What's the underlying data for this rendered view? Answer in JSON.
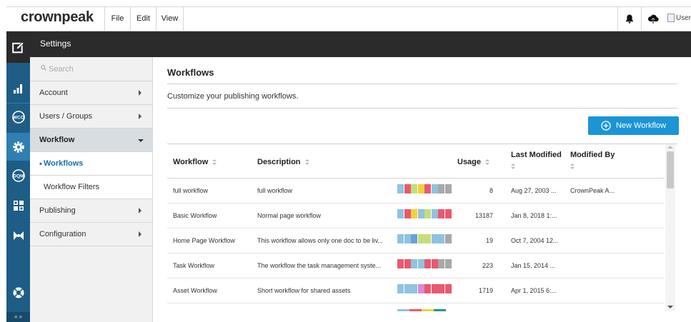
{
  "topbar": {
    "brand": "crownpeak",
    "menu": [
      "File",
      "Edit",
      "View"
    ],
    "user_alt": "User"
  },
  "settings": {
    "title": "Settings"
  },
  "sidebar": {
    "search_placeholder": "Search",
    "items": [
      {
        "label": "Account"
      },
      {
        "label": "Users / Groups"
      },
      {
        "label": "Workflow"
      },
      {
        "label": "Workflows"
      },
      {
        "label": "Workflow Filters"
      },
      {
        "label": "Publishing"
      },
      {
        "label": "Configuration"
      }
    ]
  },
  "main": {
    "title": "Workflows",
    "subtitle": "Customize your publishing workflows.",
    "new_button": "New Workflow"
  },
  "table": {
    "columns": [
      "Workflow",
      "Description",
      "Usage",
      "Last Modified",
      "Modified By"
    ],
    "rows": [
      {
        "name": "full workflow",
        "description": "full workflow",
        "usage": "8",
        "modified": "Aug 27, 2003 ...",
        "by": "CrownPeak A...",
        "swatches": [
          "#8fc3e0",
          "#e9596f",
          "#c5de7a",
          "#f0d23a",
          "#e9596f",
          "#8fc3e0",
          "#a8a8a8",
          "#a8a8a8"
        ]
      },
      {
        "name": "Basic Workflow",
        "description": "Normal page workflow",
        "usage": "13187",
        "modified": "Jan 8, 2018 1:...",
        "by": "",
        "swatches": [
          "#8fc3e0",
          "#e9596f",
          "#f0d23a",
          "#8fc3e0",
          "#c5de7a",
          "#8fc3e0",
          "#e9596f",
          "#e9596f"
        ]
      },
      {
        "name": "Home Page Workflow",
        "description": "This workflow allows only one doc to be liv...",
        "usage": "19",
        "modified": "Oct 7, 2004 12...",
        "by": "",
        "swatches": [
          "#8fc3e0",
          "#8fc3e0",
          "#6aa0d8",
          "#c5de7a",
          "#c5de7a",
          "#8fc3e0",
          "#8fc3e0",
          "#a8a8a8"
        ]
      },
      {
        "name": "Task Workflow",
        "description": "The workflow the task management syste...",
        "usage": "223",
        "modified": "Jan 15, 2014 ...",
        "by": "",
        "swatches": [
          "#e9596f",
          "#e9596f",
          "#8fc3e0",
          "#8fc3e0",
          "#e9596f",
          "#e9596f",
          "#a8a8a8",
          "#a8a8a8"
        ]
      },
      {
        "name": "Asset Workflow",
        "description": "Short workflow for shared assets",
        "usage": "1719",
        "modified": "Apr 1, 2015 6:...",
        "by": "",
        "swatches": [
          "#8fc3e0",
          "#8fc3e0",
          "#8fc3e0",
          "#d88ad8",
          "#e9596f",
          "#e9596f",
          "#e9596f",
          "#e9596f"
        ]
      }
    ]
  },
  "rail": {
    "icons": [
      "edit-icon",
      "analytics-icon",
      "wco-icon",
      "settings-gear-icon",
      "dqm-icon",
      "apps-grid-icon",
      "bowtie-icon",
      "help-lifebuoy-icon"
    ],
    "collapse": "« »"
  },
  "colors": {
    "accent": "#1b95d6",
    "rail": "#1e5d85",
    "rail_active": "#2f7fb2",
    "header_dark": "#2b2b2b",
    "brand_red": "#e8334a"
  }
}
